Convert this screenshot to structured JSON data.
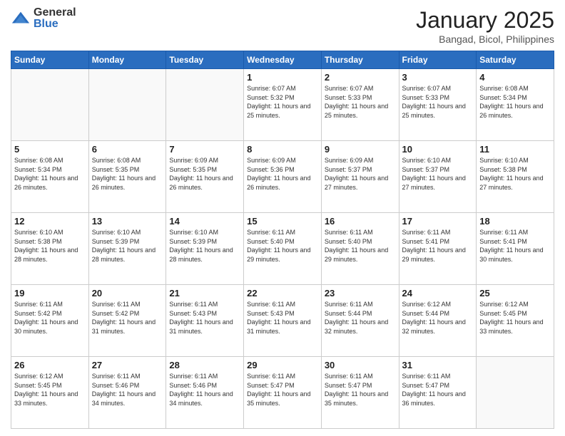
{
  "logo": {
    "general": "General",
    "blue": "Blue"
  },
  "title": {
    "month": "January 2025",
    "location": "Bangad, Bicol, Philippines"
  },
  "headers": [
    "Sunday",
    "Monday",
    "Tuesday",
    "Wednesday",
    "Thursday",
    "Friday",
    "Saturday"
  ],
  "weeks": [
    [
      {
        "day": "",
        "empty": true
      },
      {
        "day": "",
        "empty": true
      },
      {
        "day": "",
        "empty": true
      },
      {
        "day": "1",
        "sunrise": "6:07 AM",
        "sunset": "5:32 PM",
        "daylight": "11 hours and 25 minutes."
      },
      {
        "day": "2",
        "sunrise": "6:07 AM",
        "sunset": "5:33 PM",
        "daylight": "11 hours and 25 minutes."
      },
      {
        "day": "3",
        "sunrise": "6:07 AM",
        "sunset": "5:33 PM",
        "daylight": "11 hours and 25 minutes."
      },
      {
        "day": "4",
        "sunrise": "6:08 AM",
        "sunset": "5:34 PM",
        "daylight": "11 hours and 26 minutes."
      }
    ],
    [
      {
        "day": "5",
        "sunrise": "6:08 AM",
        "sunset": "5:34 PM",
        "daylight": "11 hours and 26 minutes."
      },
      {
        "day": "6",
        "sunrise": "6:08 AM",
        "sunset": "5:35 PM",
        "daylight": "11 hours and 26 minutes."
      },
      {
        "day": "7",
        "sunrise": "6:09 AM",
        "sunset": "5:35 PM",
        "daylight": "11 hours and 26 minutes."
      },
      {
        "day": "8",
        "sunrise": "6:09 AM",
        "sunset": "5:36 PM",
        "daylight": "11 hours and 26 minutes."
      },
      {
        "day": "9",
        "sunrise": "6:09 AM",
        "sunset": "5:37 PM",
        "daylight": "11 hours and 27 minutes."
      },
      {
        "day": "10",
        "sunrise": "6:10 AM",
        "sunset": "5:37 PM",
        "daylight": "11 hours and 27 minutes."
      },
      {
        "day": "11",
        "sunrise": "6:10 AM",
        "sunset": "5:38 PM",
        "daylight": "11 hours and 27 minutes."
      }
    ],
    [
      {
        "day": "12",
        "sunrise": "6:10 AM",
        "sunset": "5:38 PM",
        "daylight": "11 hours and 28 minutes."
      },
      {
        "day": "13",
        "sunrise": "6:10 AM",
        "sunset": "5:39 PM",
        "daylight": "11 hours and 28 minutes."
      },
      {
        "day": "14",
        "sunrise": "6:10 AM",
        "sunset": "5:39 PM",
        "daylight": "11 hours and 28 minutes."
      },
      {
        "day": "15",
        "sunrise": "6:11 AM",
        "sunset": "5:40 PM",
        "daylight": "11 hours and 29 minutes."
      },
      {
        "day": "16",
        "sunrise": "6:11 AM",
        "sunset": "5:40 PM",
        "daylight": "11 hours and 29 minutes."
      },
      {
        "day": "17",
        "sunrise": "6:11 AM",
        "sunset": "5:41 PM",
        "daylight": "11 hours and 29 minutes."
      },
      {
        "day": "18",
        "sunrise": "6:11 AM",
        "sunset": "5:41 PM",
        "daylight": "11 hours and 30 minutes."
      }
    ],
    [
      {
        "day": "19",
        "sunrise": "6:11 AM",
        "sunset": "5:42 PM",
        "daylight": "11 hours and 30 minutes."
      },
      {
        "day": "20",
        "sunrise": "6:11 AM",
        "sunset": "5:42 PM",
        "daylight": "11 hours and 31 minutes."
      },
      {
        "day": "21",
        "sunrise": "6:11 AM",
        "sunset": "5:43 PM",
        "daylight": "11 hours and 31 minutes."
      },
      {
        "day": "22",
        "sunrise": "6:11 AM",
        "sunset": "5:43 PM",
        "daylight": "11 hours and 31 minutes."
      },
      {
        "day": "23",
        "sunrise": "6:11 AM",
        "sunset": "5:44 PM",
        "daylight": "11 hours and 32 minutes."
      },
      {
        "day": "24",
        "sunrise": "6:12 AM",
        "sunset": "5:44 PM",
        "daylight": "11 hours and 32 minutes."
      },
      {
        "day": "25",
        "sunrise": "6:12 AM",
        "sunset": "5:45 PM",
        "daylight": "11 hours and 33 minutes."
      }
    ],
    [
      {
        "day": "26",
        "sunrise": "6:12 AM",
        "sunset": "5:45 PM",
        "daylight": "11 hours and 33 minutes."
      },
      {
        "day": "27",
        "sunrise": "6:11 AM",
        "sunset": "5:46 PM",
        "daylight": "11 hours and 34 minutes."
      },
      {
        "day": "28",
        "sunrise": "6:11 AM",
        "sunset": "5:46 PM",
        "daylight": "11 hours and 34 minutes."
      },
      {
        "day": "29",
        "sunrise": "6:11 AM",
        "sunset": "5:47 PM",
        "daylight": "11 hours and 35 minutes."
      },
      {
        "day": "30",
        "sunrise": "6:11 AM",
        "sunset": "5:47 PM",
        "daylight": "11 hours and 35 minutes."
      },
      {
        "day": "31",
        "sunrise": "6:11 AM",
        "sunset": "5:47 PM",
        "daylight": "11 hours and 36 minutes."
      },
      {
        "day": "",
        "empty": true
      }
    ]
  ]
}
